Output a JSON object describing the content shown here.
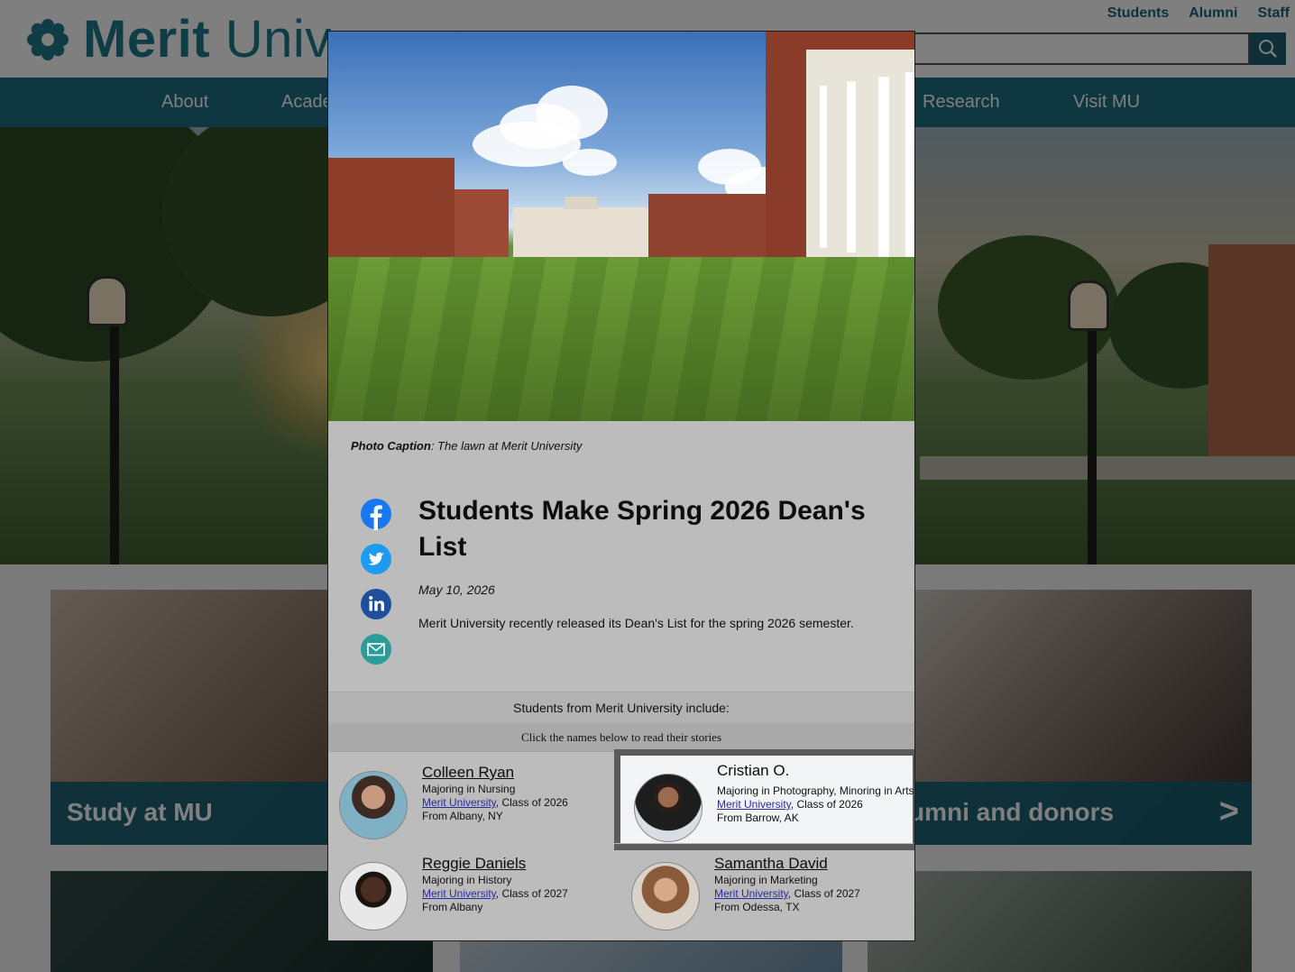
{
  "site": {
    "logo_bold": "Merit",
    "logo_light": "Univ",
    "top_links": [
      "Students",
      "Alumni",
      "Staff"
    ],
    "nav": [
      "About",
      "Acade",
      "Research",
      "Visit MU"
    ],
    "cards": [
      {
        "label": "Study at MU"
      },
      {
        "label": "umni and donors",
        "arrow": ">"
      }
    ]
  },
  "modal": {
    "caption_label": "Photo Caption",
    "caption_text": ": The lawn at Merit University",
    "social": [
      "facebook-icon",
      "twitter-icon",
      "linkedin-icon",
      "email-icon"
    ],
    "title": "Students Make Spring 2026 Dean's List",
    "date": "May 10, 2026",
    "body": "Merit University recently released its Dean's List for the spring 2026 semester.",
    "include_heading": "Students from Merit University include:",
    "click_hint": "Click the names below to read their stories",
    "students": [
      {
        "name": "Colleen Ryan",
        "major": "Majoring in Nursing",
        "school": "Merit University",
        "class": ", Class of 2026",
        "from": "From Albany, NY"
      },
      {
        "name": "Cristian O.",
        "major": "Majoring in Photography, Minoring in Arts",
        "school": "Merit University",
        "class": ", Class of 2026",
        "from": "From Barrow, AK"
      },
      {
        "name": "Reggie Daniels",
        "major": "Majoring in History",
        "school": "Merit University",
        "class": ", Class of 2027",
        "from": "From Albany"
      },
      {
        "name": "Samantha David",
        "major": "Majoring in Marketing",
        "school": "Merit University",
        "class": ", Class of 2027",
        "from": "From Odessa, TX"
      }
    ]
  },
  "colors": {
    "brand_teal": "#1c6e82",
    "facebook": "#1877f2",
    "twitter": "#1d9bf0",
    "linkedin": "#1f4e9c",
    "email": "#2a9d9a"
  }
}
